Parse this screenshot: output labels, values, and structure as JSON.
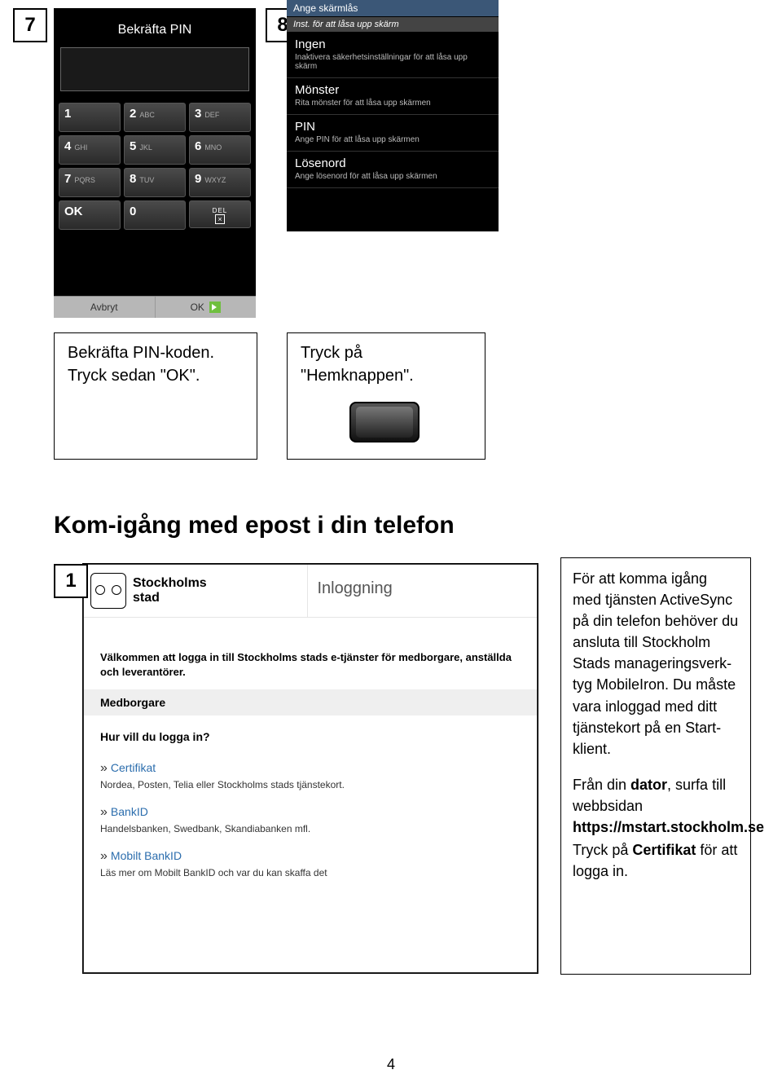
{
  "step7": {
    "num": "7",
    "screen_title": "Bekräfta PIN",
    "keys": [
      {
        "n": "1",
        "l": ""
      },
      {
        "n": "2",
        "l": "ABC"
      },
      {
        "n": "3",
        "l": "DEF"
      },
      {
        "n": "4",
        "l": "GHI"
      },
      {
        "n": "5",
        "l": "JKL"
      },
      {
        "n": "6",
        "l": "MNO"
      },
      {
        "n": "7",
        "l": "PQRS"
      },
      {
        "n": "8",
        "l": "TUV"
      },
      {
        "n": "9",
        "l": "WXYZ"
      }
    ],
    "ok_key": "OK",
    "zero": "0",
    "del_top": "DEL",
    "del_sym": "⌫",
    "avbryt": "Avbryt",
    "bottom_ok": "OK",
    "instruction": "Bekräfta PIN-koden. Tryck sedan \"OK\"."
  },
  "step8": {
    "num": "8",
    "hdr1": "Ange skärmlås",
    "hdr2": "Inst. för att låsa upp skärm",
    "opts": [
      {
        "t": "Ingen",
        "d": "Inaktivera säkerhetsinställningar för att låsa upp skärm"
      },
      {
        "t": "Mönster",
        "d": "Rita mönster för att låsa upp skärmen"
      },
      {
        "t": "PIN",
        "d": "Ange PIN för att låsa upp skärmen"
      },
      {
        "t": "Lösenord",
        "d": "Ange lösenord för att låsa upp skärmen"
      }
    ],
    "instruction": "Tryck på \"Hemknappen\"."
  },
  "section_heading": "Kom-igång med epost i din telefon",
  "step1": {
    "num": "1",
    "brand_line1": "Stockholms",
    "brand_line2": "stad",
    "page_title": "Inloggning",
    "welcome": "Välkommen att logga in till Stockholms stads e-tjänster för medborgare, anställda och leverantörer.",
    "grey": "Medborgare",
    "question": "Hur vill du logga in?",
    "methods": [
      {
        "link": "Certifikat",
        "sub": "Nordea, Posten, Telia eller Stockholms stads tjänstekort."
      },
      {
        "link": "BankID",
        "sub": "Handelsbanken, Swedbank, Skandiabanken mfl."
      },
      {
        "link": "Mobilt BankID",
        "sub": "Läs mer om Mobilt BankID och var du kan skaffa det"
      }
    ],
    "info_p1": "För att komma igång med tjänsten ActiveSync på din telefon behöver du ansluta till Stockholm Stads manageringsverk-tyg MobileIron. Du måste vara inloggad med ditt tjänstekort på en Start-klient.",
    "info_p2a": "Från din ",
    "info_p2_bold1": "dator",
    "info_p2b": ", surfa till webbsidan ",
    "info_url": "https://mstart.stockholm.se",
    "info_p3a": "Tryck på ",
    "info_p3_bold": "Certifikat",
    "info_p3b": " för att logga in."
  },
  "page_number": "4"
}
